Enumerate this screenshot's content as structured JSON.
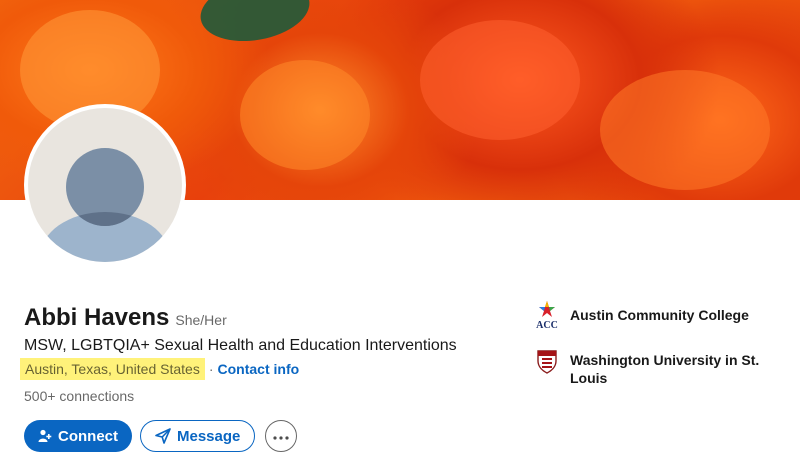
{
  "profile": {
    "name": "Abbi Havens",
    "pronouns": "She/Her",
    "headline": "MSW, LGBTQIA+ Sexual Health and Education Interventions",
    "location": "Austin, Texas, United States",
    "separator": "·",
    "contact_info_label": "Contact info",
    "connections": "500+ connections"
  },
  "actions": {
    "connect_label": "Connect",
    "message_label": "Message"
  },
  "education": [
    {
      "name": "Austin Community College",
      "logo_text": "ACC",
      "icon": "acc-star-logo"
    },
    {
      "name": "Washington University in St. Louis",
      "icon": "washu-shield-logo"
    }
  ],
  "colors": {
    "primary": "#0a66c2",
    "highlight": "#fff27a",
    "cover": "#e8400c"
  }
}
